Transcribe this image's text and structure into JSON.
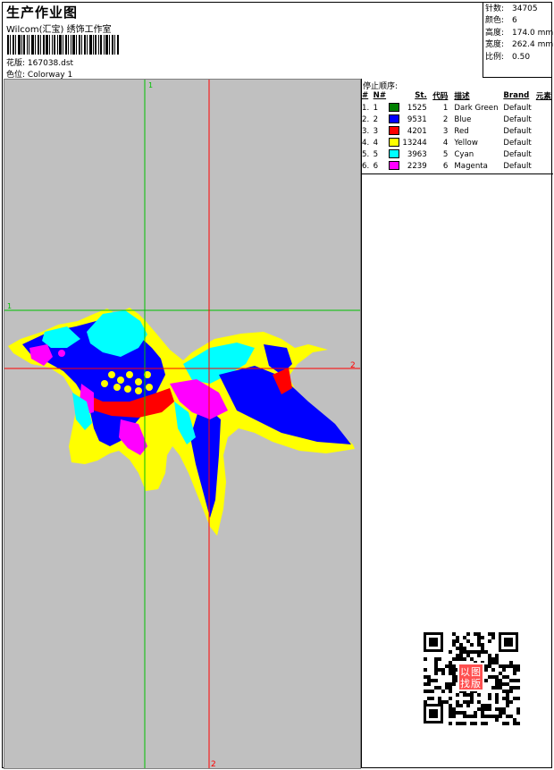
{
  "header": {
    "title": "生产作业图",
    "company": "Wilcom(汇宝) 绣饰工作室",
    "design_label": "花版:",
    "design_value": "167038.dst",
    "colorway_label": "色位:",
    "colorway_value": "Colorway 1"
  },
  "stats": [
    {
      "label": "针数:",
      "value": "34705"
    },
    {
      "label": "颜色:",
      "value": "6"
    },
    {
      "label": "高度:",
      "value": "174.0 mm"
    },
    {
      "label": "宽度:",
      "value": "262.4 mm"
    },
    {
      "label": "比例:",
      "value": "0.50"
    }
  ],
  "stop_sequence": {
    "title": "停止顺序:",
    "headers": [
      "#",
      "N#",
      "St.",
      "代码",
      "描述",
      "Brand",
      "元素"
    ],
    "rows": [
      {
        "idx": "1.",
        "n": "1",
        "color": "#008000",
        "st": "1525",
        "code": "1",
        "desc": "Dark Green",
        "brand": "Default"
      },
      {
        "idx": "2.",
        "n": "2",
        "color": "#0000ff",
        "st": "9531",
        "code": "2",
        "desc": "Blue",
        "brand": "Default"
      },
      {
        "idx": "3.",
        "n": "3",
        "color": "#ff0000",
        "st": "4201",
        "code": "3",
        "desc": "Red",
        "brand": "Default"
      },
      {
        "idx": "4.",
        "n": "4",
        "color": "#ffff00",
        "st": "13244",
        "code": "4",
        "desc": "Yellow",
        "brand": "Default"
      },
      {
        "idx": "5.",
        "n": "5",
        "color": "#00ffff",
        "st": "3963",
        "code": "5",
        "desc": "Cyan",
        "brand": "Default"
      },
      {
        "idx": "6.",
        "n": "6",
        "color": "#ff00ff",
        "st": "2239",
        "code": "6",
        "desc": "Magenta",
        "brand": "Default"
      }
    ]
  },
  "guides": {
    "green_v_label": "1",
    "green_h_label": "1",
    "red_v_label": "2",
    "red_h_label": "2"
  },
  "stamp": {
    "chars": [
      "以",
      "图",
      "找",
      "版"
    ]
  }
}
